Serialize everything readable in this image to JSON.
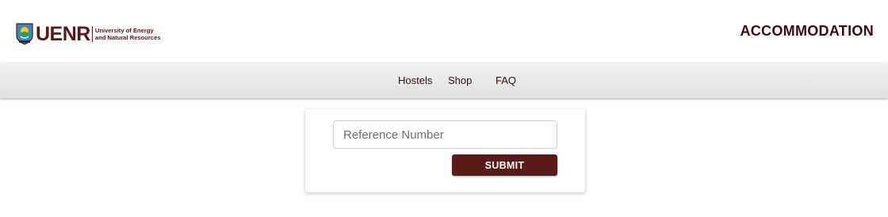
{
  "header": {
    "logo": {
      "wordmark": "UENR",
      "fullname_line1": "University of Energy",
      "fullname_line2": "and Natural Resources",
      "emblem_icon": "university-crest-icon",
      "brand_color": "#5a1717"
    },
    "title": "ACCOMMODATION"
  },
  "navbar": {
    "links": [
      {
        "label": "Hostels"
      },
      {
        "label": "Shop"
      },
      {
        "label": "FAQ"
      }
    ]
  },
  "form": {
    "reference_input": {
      "value": "",
      "placeholder": "Reference Number"
    },
    "submit_label": "SUBMIT",
    "button_color": "#5a1a1a"
  }
}
